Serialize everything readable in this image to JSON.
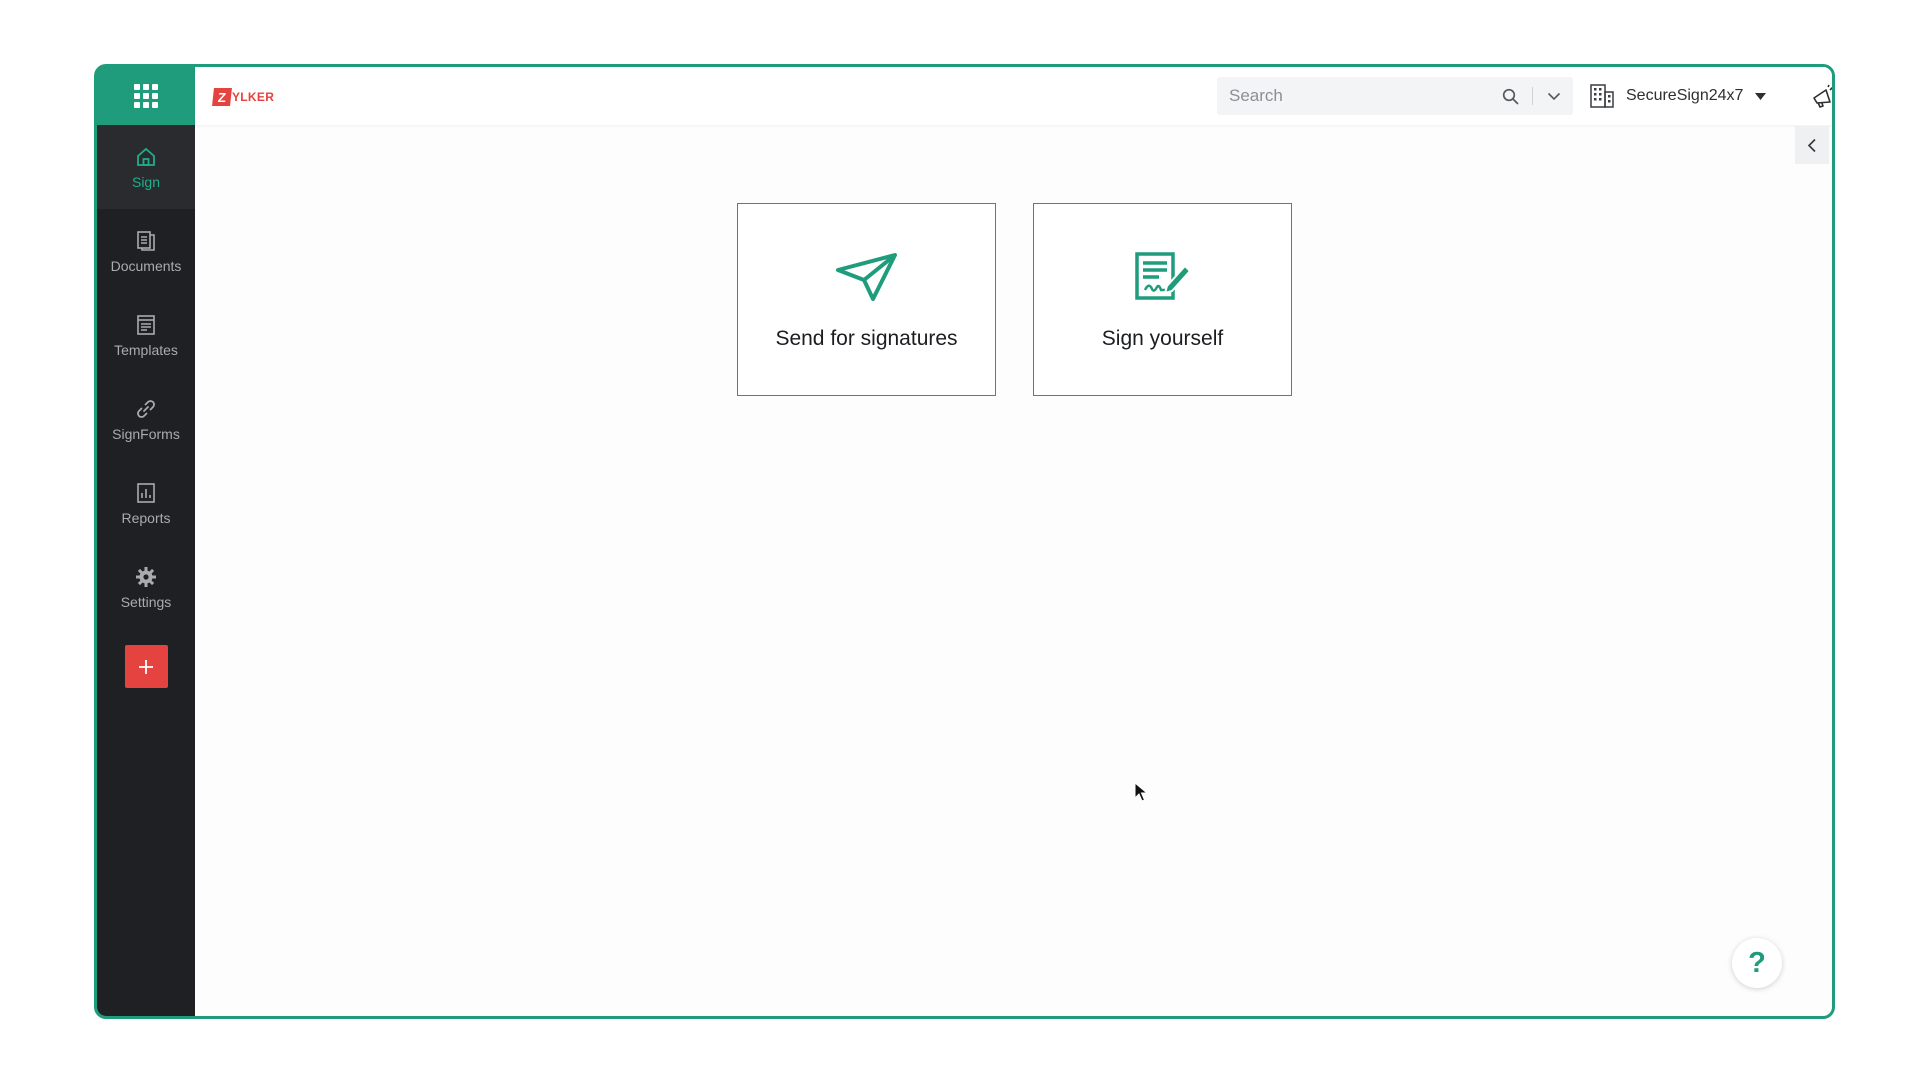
{
  "brand": {
    "logo_letter": "Z",
    "logo_text": "YLKER",
    "accent": "#1e9c7c",
    "logo_color": "#e5433f"
  },
  "sidebar": {
    "launcher_icon": "apps-grid-icon",
    "items": [
      {
        "label": "Sign",
        "icon": "home-icon",
        "active": true
      },
      {
        "label": "Documents",
        "icon": "documents-icon",
        "active": false
      },
      {
        "label": "Templates",
        "icon": "templates-icon",
        "active": false
      },
      {
        "label": "SignForms",
        "icon": "link-icon",
        "active": false
      },
      {
        "label": "Reports",
        "icon": "reports-icon",
        "active": false
      },
      {
        "label": "Settings",
        "icon": "gear-icon",
        "active": false
      }
    ],
    "add_button_icon": "plus-icon",
    "add_button_color": "#e5433f"
  },
  "topbar": {
    "search": {
      "placeholder": "Search",
      "value": ""
    },
    "org": {
      "name": "SecureSign24x7",
      "icon": "building-icon"
    },
    "announce_icon": "megaphone-icon",
    "avatar_icon": "avatar-icon"
  },
  "main": {
    "cards": [
      {
        "label": "Send for signatures",
        "icon": "paper-plane-icon"
      },
      {
        "label": "Sign yourself",
        "icon": "sign-document-icon"
      }
    ],
    "help_label": "?",
    "collapse_icon": "chevron-left-icon"
  }
}
